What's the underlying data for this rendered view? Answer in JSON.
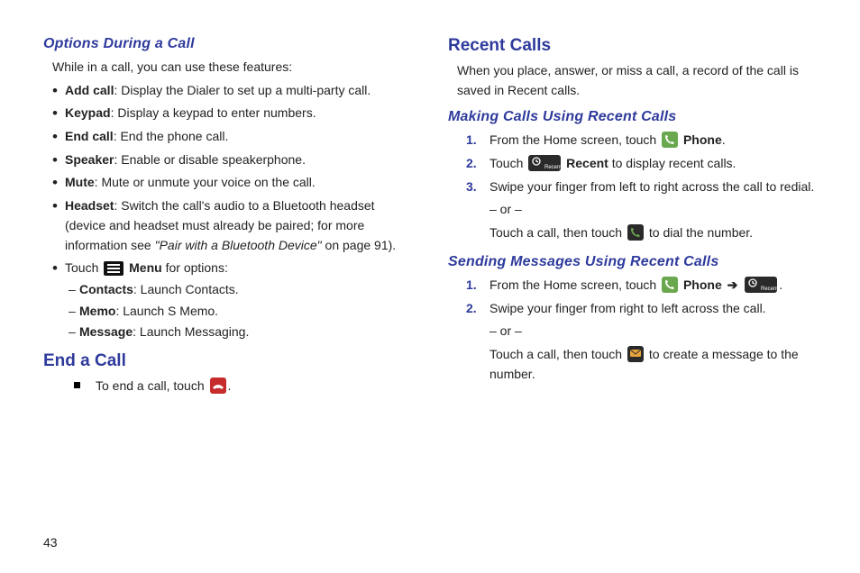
{
  "pageNumber": "43",
  "left": {
    "section1": {
      "title": "Options During a Call",
      "intro": "While in a call, you can use these features:",
      "items": [
        {
          "term": "Add call",
          "desc": ": Display the Dialer to set up a multi-party call."
        },
        {
          "term": "Keypad",
          "desc": ": Display a keypad to enter numbers."
        },
        {
          "term": "End call",
          "desc": ": End the phone call."
        },
        {
          "term": "Speaker",
          "desc": ": Enable or disable speakerphone."
        },
        {
          "term": "Mute",
          "desc": ": Mute or unmute your voice on the call."
        },
        {
          "term": "Headset",
          "desc": ": Switch the call's audio to a Bluetooth headset (device and headset must already be paired; for more information see ",
          "linkText": "\"Pair with a Bluetooth Device\"",
          "tail": " on page 91)."
        }
      ],
      "touchPrefix": "Touch ",
      "touchLabel": "Menu",
      "touchSuffix": " for options:",
      "subitems": [
        {
          "term": "Contacts",
          "desc": ": Launch Contacts."
        },
        {
          "term": "Memo",
          "desc": ": Launch S Memo."
        },
        {
          "term": "Message",
          "desc": ": Launch Messaging."
        }
      ]
    },
    "section2": {
      "title": "End a Call",
      "text_a": "To end a call, touch ",
      "text_b": "."
    }
  },
  "right": {
    "section1": {
      "title": "Recent Calls",
      "intro": "When you place, answer, or miss a call, a record of the call is saved in Recent calls."
    },
    "section2": {
      "title": "Making Calls Using Recent Calls",
      "steps": {
        "s1_a": "From the Home screen, touch ",
        "s1_b": "Phone",
        "s1_c": ".",
        "s2_a": "Touch ",
        "s2_b": "Recent",
        "s2_c": " to display recent calls.",
        "s3_a": "Swipe your finger from left to right across the call to redial.",
        "s3_or": "– or –",
        "s3_b1": "Touch a call, then touch ",
        "s3_b2": " to dial the number."
      }
    },
    "section3": {
      "title": "Sending Messages Using Recent Calls",
      "steps": {
        "s1_a": "From the Home screen, touch ",
        "s1_b": "Phone",
        "s1_arrow": "➔",
        "s1_c": ".",
        "s2_a": "Swipe your finger from right to left across the call.",
        "s2_or": "– or –",
        "s2_b1": "Touch a call, then touch ",
        "s2_b2": " to create a message to the number."
      }
    }
  }
}
